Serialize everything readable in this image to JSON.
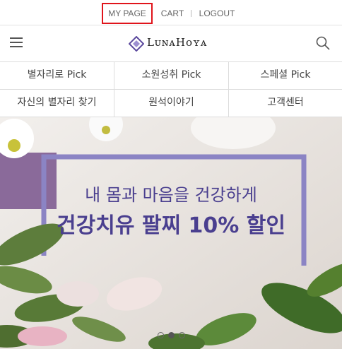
{
  "top_nav": {
    "mypage_label": "MY PAGE",
    "cart_label": "CART",
    "logout_label": "LOGOUT"
  },
  "header": {
    "brand": "LunaHoya",
    "brand_display": "LᴜɴᴀHᴏʏᴀ",
    "menu_icon": "hamburger-menu-icon",
    "search_icon": "search-icon"
  },
  "categories": {
    "row1": [
      "별자리로 Pick",
      "소원성취 Pick",
      "스페셜 Pick"
    ],
    "row2": [
      "자신의 별자리 찾기",
      "원석이야기",
      "고객센터"
    ]
  },
  "banner": {
    "headline_line1": "내 몸과 마음을 건강하게",
    "headline_line2": "건강치유 팔찌 10% 할인",
    "slide_count": 3,
    "active_slide": 2
  },
  "colors": {
    "highlight_border": "#e0141b",
    "banner_text": "#4a3f8f",
    "banner_frame": "#8b84c4"
  }
}
